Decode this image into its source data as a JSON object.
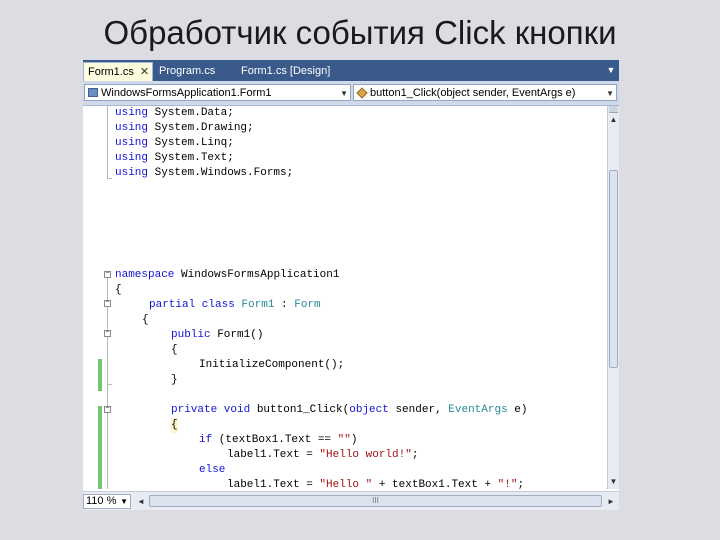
{
  "slide": {
    "title": "Обработчик события Click кнопки"
  },
  "tabs": [
    {
      "label": "Form1.cs",
      "close": "✕"
    },
    {
      "label": "Program.cs"
    },
    {
      "label": "Form1.cs [Design]"
    }
  ],
  "navbar": {
    "class_combo": "WindowsFormsApplication1.Form1",
    "member_combo": "button1_Click(object sender, EventArgs e)"
  },
  "code": {
    "l1": [
      "using",
      " System.Data;"
    ],
    "l2": [
      "using",
      " System.Drawing;"
    ],
    "l3": [
      "using",
      " System.Linq;"
    ],
    "l4": [
      "using",
      " System.Text;"
    ],
    "l5": [
      "using",
      " System.Windows.Forms;"
    ],
    "l6": [
      "namespace",
      " WindowsFormsApplication1"
    ],
    "l7": "{",
    "l8": {
      "kw": "partial class",
      "name": " Form1",
      "sep": " : ",
      "base": "Form"
    },
    "l9": "{",
    "l10": {
      "kw": "public",
      "rest": " Form1()"
    },
    "l11": "{",
    "l12": "InitializeComponent();",
    "l13": "}",
    "l14": {
      "kw": "private void",
      "name": " button1_Click(",
      "kw2": "object",
      "mid": " sender, ",
      "ty": "EventArgs",
      "end": " e)"
    },
    "l15": "{",
    "l16": {
      "kw": "if",
      "rest": " (textBox1.Text == ",
      "str": "\"\"",
      "end": ")"
    },
    "l17": {
      "pre": "label1.Text = ",
      "str": "\"Hello world!\"",
      "end": ";"
    },
    "l18": "else",
    "l19": {
      "pre": "label1.Text = ",
      "str": "\"Hello \"",
      "mid": " + textBox1.Text + ",
      "str2": "\"!\"",
      "end": ";"
    },
    "l20": "}",
    "l21": "}",
    "l22": "}"
  },
  "status": {
    "zoom": "110 %",
    "scroll_grip": "III"
  },
  "icons": {
    "close": "close-icon",
    "dropdown": "chevron-down-icon",
    "collapse": "collapse-minus-icon"
  },
  "colors": {
    "keyword": "#1414d8",
    "type": "#2a8a9a",
    "string": "#a31515",
    "changed_margin": "#71c671",
    "tab_bar": "#3a5a8c"
  }
}
